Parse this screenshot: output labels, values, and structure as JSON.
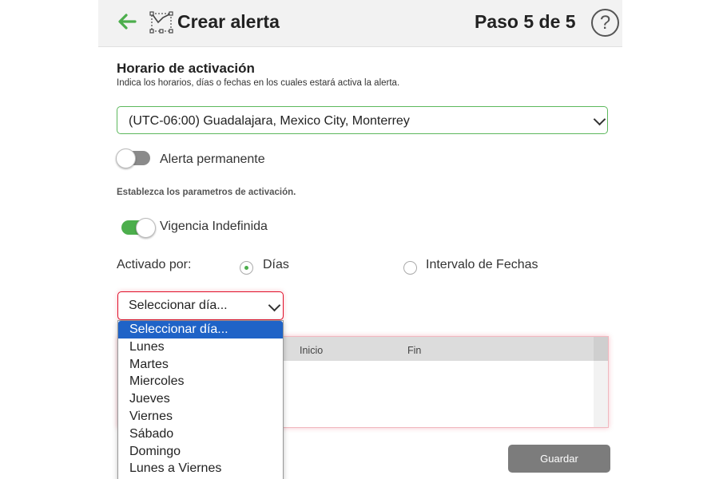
{
  "header": {
    "title": "Crear alerta",
    "step": "Paso 5 de 5",
    "help_symbol": "?"
  },
  "schedule": {
    "title": "Horario de activación",
    "description": "Indica los horarios, días o fechas en los cuales estará activa la alerta.",
    "timezone_value": "(UTC-06:00) Guadalajara, Mexico City, Monterrey"
  },
  "permanent": {
    "label": "Alerta permanente",
    "enabled": false
  },
  "params_text": "Establezca los parametros de activación.",
  "validity": {
    "label": "Vigencia Indefinida",
    "enabled": true
  },
  "activation": {
    "label": "Activado por:",
    "options": [
      "Días",
      "Intervalo de Fechas"
    ],
    "selected": "Días"
  },
  "day_select": {
    "value": "Seleccionar día...",
    "options": [
      "Seleccionar día...",
      "Lunes",
      "Martes",
      "Miercoles",
      "Jueves",
      "Viernes",
      "Sábado",
      "Domingo",
      "Lunes a Viernes"
    ]
  },
  "table": {
    "columns": [
      "Inicio",
      "Fin"
    ]
  },
  "save_button": "Guardar",
  "colors": {
    "accent_green": "#4cae4c",
    "error_red": "#e0102a",
    "selected_blue": "#1f63c7",
    "button_gray": "#7c7c7c"
  }
}
